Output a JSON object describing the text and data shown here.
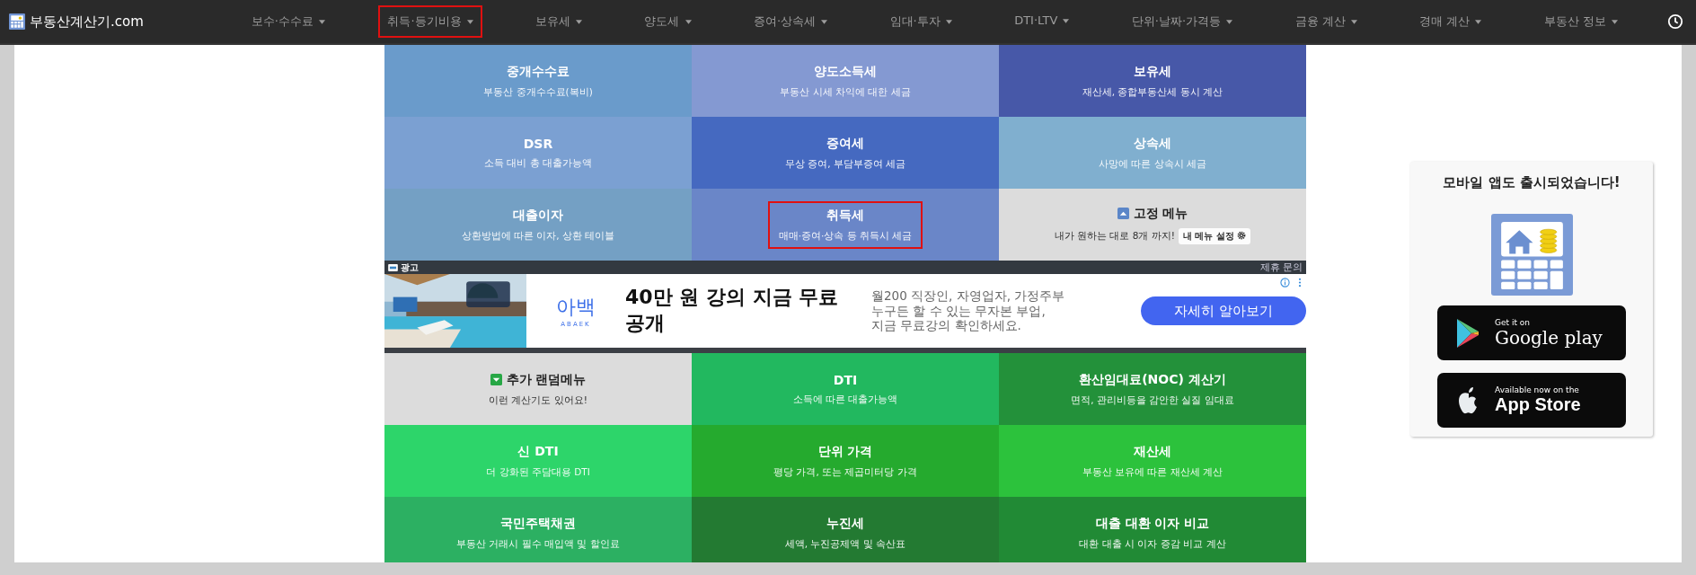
{
  "nav": {
    "logo": "부동산계산기.com",
    "items": [
      {
        "label": "보수·수수료",
        "highlighted": false
      },
      {
        "label": "취득·등기비용",
        "highlighted": true
      },
      {
        "label": "보유세",
        "highlighted": false
      },
      {
        "label": "양도세",
        "highlighted": false
      },
      {
        "label": "증여·상속세",
        "highlighted": false
      },
      {
        "label": "임대·투자",
        "highlighted": false
      },
      {
        "label": "DTI·LTV",
        "highlighted": false
      },
      {
        "label": "단위·날짜·가격등",
        "highlighted": false
      },
      {
        "label": "금융 계산",
        "highlighted": false
      },
      {
        "label": "경매 계산",
        "highlighted": false
      },
      {
        "label": "부동산 정보",
        "highlighted": false
      }
    ]
  },
  "top_tiles": [
    {
      "kind": "calc",
      "title": "중개수수료",
      "subtitle": "부동산 중개수수료(복비)",
      "color": "#6a9bcb",
      "highlighted": false
    },
    {
      "kind": "calc",
      "title": "양도소득세",
      "subtitle": "부동산 시세 차익에 대한 세금",
      "color": "#8499d2",
      "highlighted": false
    },
    {
      "kind": "calc",
      "title": "보유세",
      "subtitle": "재산세, 종합부동산세 동시 계산",
      "color": "#4758a8",
      "highlighted": false
    },
    {
      "kind": "calc",
      "title": "DSR",
      "subtitle": "소득 대비 총 대출가능액",
      "color": "#7ba0d2",
      "highlighted": false
    },
    {
      "kind": "calc",
      "title": "증여세",
      "subtitle": "무상 증여, 부담부증여 세금",
      "color": "#4569c0",
      "highlighted": false
    },
    {
      "kind": "calc",
      "title": "상속세",
      "subtitle": "사망에 따른 상속시 세금",
      "color": "#80afcf",
      "highlighted": false
    },
    {
      "kind": "calc",
      "title": "대출이자",
      "subtitle": "상환방법에 따른 이자, 상환 테이블",
      "color": "#74a0c4",
      "highlighted": false
    },
    {
      "kind": "calc",
      "title": "취득세",
      "subtitle": "매매·증여·상속 등 취득시 세금",
      "color": "#6a86c8",
      "highlighted": true
    },
    {
      "kind": "menu",
      "title": "고정 메뉴",
      "subtitle": "내가 원하는 대로 8개 까지!",
      "button": "내 메뉴 설정",
      "color": "#dcdcdc",
      "highlighted": false
    }
  ],
  "ad": {
    "label": "광고",
    "contact": "제휴 문의",
    "brand": "아백",
    "brand_sub": "ABAEK",
    "headline": "40만 원 강의 지금 무료 공개",
    "body_lines": [
      "월200 직장인, 자영업자, 가정주부",
      "누구든 할 수 있는 무자본 부업,",
      "지금 무료강의 확인하세요."
    ],
    "button": "자세히 알아보기"
  },
  "bottom_tiles": [
    {
      "kind": "menu",
      "title": "추가 랜덤메뉴",
      "subtitle": "이런 계산기도 있어요!",
      "color": "#dcdcdc",
      "highlighted": false
    },
    {
      "kind": "calc",
      "title": "DTI",
      "subtitle": "소득에 따른 대출가능액",
      "color": "#22b85f",
      "highlighted": false
    },
    {
      "kind": "calc",
      "title": "환산임대료(NOC) 계산기",
      "subtitle": "면적, 관리비등을 감안한 실질 임대료",
      "color": "#23913a",
      "highlighted": false
    },
    {
      "kind": "calc",
      "title": "신 DTI",
      "subtitle": "더 강화된 주담대용 DTI",
      "color": "#2dd56a",
      "highlighted": false
    },
    {
      "kind": "calc",
      "title": "단위 가격",
      "subtitle": "평당 가격, 또는 제곱미터당 가격",
      "color": "#25aa2e",
      "highlighted": false
    },
    {
      "kind": "calc",
      "title": "재산세",
      "subtitle": "부동산 보유에 따른 재산세 계산",
      "color": "#2cc23c",
      "highlighted": false
    },
    {
      "kind": "calc",
      "title": "국민주택채권",
      "subtitle": "부동산 거래시 필수 매입액 및 할인료",
      "color": "#2cb062",
      "highlighted": false
    },
    {
      "kind": "calc",
      "title": "누진세",
      "subtitle": "세액, 누진공제액 및 속산표",
      "color": "#237a32",
      "highlighted": false
    },
    {
      "kind": "calc",
      "title": "대출 대환 이자 비교",
      "subtitle": "대환 대출 시 이자 증감 비교 계산",
      "color": "#218a35",
      "highlighted": false
    }
  ],
  "app_panel": {
    "title": "모바일 앱도 출시되었습니다!",
    "google": {
      "small": "Get it on",
      "big": "Google play"
    },
    "apple": {
      "small": "Available now on the",
      "big": "App Store"
    }
  }
}
